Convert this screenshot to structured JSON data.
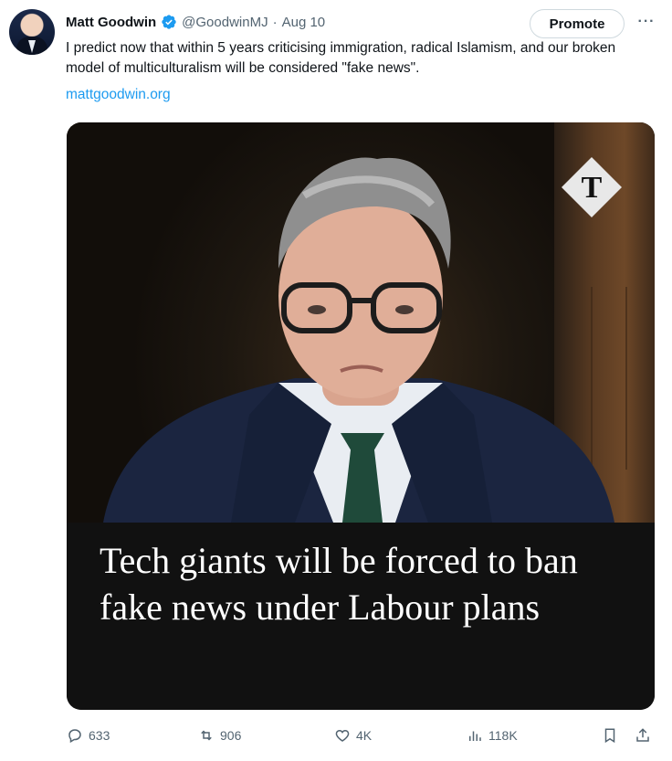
{
  "author": {
    "name": "Matt Goodwin",
    "handle": "@GoodwinMJ",
    "separator": "·",
    "date": "Aug 10",
    "verified_icon": "verified-badge-icon"
  },
  "header": {
    "promote_label": "Promote",
    "more_label": "···"
  },
  "tweet": {
    "text": "I predict now that within 5 years criticising immigration, radical Islamism, and our broken model of multiculturalism will be considered \"fake news\".",
    "link": "mattgoodwin.org"
  },
  "card": {
    "headline": "Tech giants will be forced to ban fake news under Labour plans",
    "logo_icon": "telegraph-t-logo-icon"
  },
  "actions": {
    "replies": "633",
    "retweets": "906",
    "likes": "4K",
    "views": "118K"
  },
  "colors": {
    "accent": "#1d9bf0",
    "secondary_text": "#536471",
    "headline_bg": "#111111"
  }
}
